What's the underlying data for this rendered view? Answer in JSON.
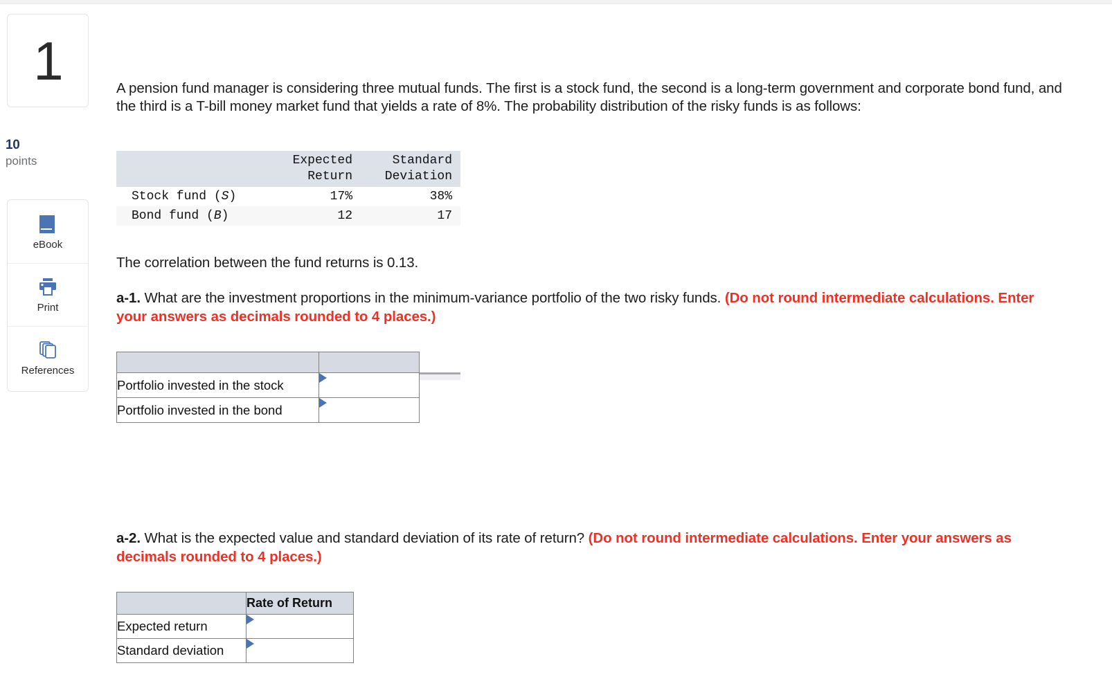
{
  "question": {
    "number": "1",
    "points_value": "10",
    "points_label": "points"
  },
  "tools": [
    {
      "name": "ebook",
      "icon": "book-icon",
      "label": "eBook"
    },
    {
      "name": "print",
      "icon": "printer-icon",
      "label": "Print"
    },
    {
      "name": "references",
      "icon": "pages-stack-icon",
      "label": "References"
    }
  ],
  "body": {
    "intro": "A pension fund manager is considering three mutual funds. The first is a stock fund, the second is a long-term government and corporate bond fund, and the third is a T-bill money market fund that yields a rate of 8%. The probability distribution of the risky funds is as follows:",
    "correlation": "The correlation between the fund returns is 0.13."
  },
  "data_table": {
    "headers": [
      "",
      "Expected Return",
      "Standard Deviation"
    ],
    "header_lines": {
      "col2_line1": "Expected",
      "col2_line2": "Return",
      "col3_line1": "Standard",
      "col3_line2": "Deviation"
    },
    "rows": [
      {
        "label_prefix": "Stock fund (",
        "label_symbol": "S",
        "label_suffix": ")",
        "expected_return": "17%",
        "standard_deviation": "38%"
      },
      {
        "label_prefix": "Bond fund (",
        "label_symbol": "B",
        "label_suffix": ")",
        "expected_return": "12",
        "standard_deviation": "17"
      }
    ]
  },
  "questions": [
    {
      "id": "a-1",
      "label": "a-1.",
      "text": " What are the investment proportions in the minimum-variance portfolio of the two risky funds. ",
      "instruction": "(Do not round intermediate calculations. Enter your answers as decimals rounded to 4 places.)",
      "answer_table": {
        "header_blank": "",
        "header_value": "",
        "rows": [
          {
            "label": "Portfolio invested in the stock",
            "value": ""
          },
          {
            "label": "Portfolio invested in the bond",
            "value": ""
          }
        ]
      }
    },
    {
      "id": "a-2",
      "label": "a-2.",
      "text": " What is the expected value and standard deviation of its rate of return? ",
      "instruction": "(Do not round intermediate calculations. Enter your answers as decimals rounded to 4 places.)",
      "answer_table": {
        "header_blank": "",
        "header_value": "Rate of Return",
        "rows": [
          {
            "label": "Expected return",
            "value": ""
          },
          {
            "label": "Standard deviation",
            "value": ""
          }
        ]
      }
    }
  ],
  "colors": {
    "instruction_red": "#ee3124",
    "points_navy": "#1f3864",
    "icon_blue": "#4a74b4",
    "table_header_blue_gray": "#dde1e8",
    "answer_header_blue_gray": "#d5dae3"
  }
}
